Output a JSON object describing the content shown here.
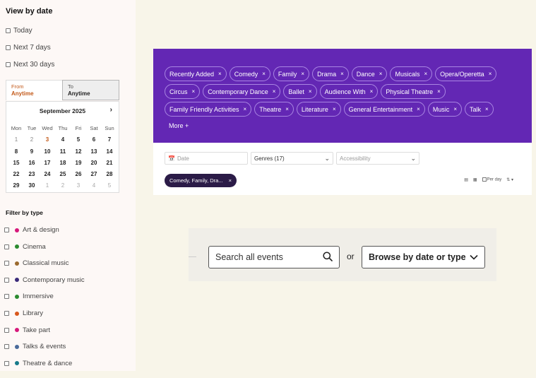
{
  "sidebar": {
    "view_by_date_title": "View by date",
    "date_options": [
      {
        "label": "Today"
      },
      {
        "label": "Next 7 days"
      },
      {
        "label": "Next 30 days"
      }
    ],
    "range": {
      "from_label": "From",
      "from_value": "Anytime",
      "to_label": "To",
      "to_value": "Anytime"
    },
    "calendar": {
      "month": "September 2025",
      "next_icon": "chevron-right-icon",
      "weekdays": [
        "Mon",
        "Tue",
        "Wed",
        "Thu",
        "Fri",
        "Sat",
        "Sun"
      ],
      "days": [
        {
          "d": "1",
          "s": "past"
        },
        {
          "d": "2",
          "s": "past"
        },
        {
          "d": "3",
          "s": "today"
        },
        {
          "d": "4",
          "s": "fut"
        },
        {
          "d": "5",
          "s": "fut"
        },
        {
          "d": "6",
          "s": "fut"
        },
        {
          "d": "7",
          "s": "fut"
        },
        {
          "d": "8",
          "s": "fut"
        },
        {
          "d": "9",
          "s": "fut"
        },
        {
          "d": "10",
          "s": "fut"
        },
        {
          "d": "11",
          "s": "fut"
        },
        {
          "d": "12",
          "s": "fut"
        },
        {
          "d": "13",
          "s": "fut"
        },
        {
          "d": "14",
          "s": "fut"
        },
        {
          "d": "15",
          "s": "fut"
        },
        {
          "d": "16",
          "s": "fut"
        },
        {
          "d": "17",
          "s": "fut"
        },
        {
          "d": "18",
          "s": "fut"
        },
        {
          "d": "19",
          "s": "fut"
        },
        {
          "d": "20",
          "s": "fut"
        },
        {
          "d": "21",
          "s": "fut"
        },
        {
          "d": "22",
          "s": "fut"
        },
        {
          "d": "23",
          "s": "fut"
        },
        {
          "d": "24",
          "s": "fut"
        },
        {
          "d": "25",
          "s": "fut"
        },
        {
          "d": "26",
          "s": "fut"
        },
        {
          "d": "27",
          "s": "fut"
        },
        {
          "d": "28",
          "s": "fut"
        },
        {
          "d": "29",
          "s": "fut"
        },
        {
          "d": "30",
          "s": "fut"
        },
        {
          "d": "1",
          "s": "next"
        },
        {
          "d": "2",
          "s": "next"
        },
        {
          "d": "3",
          "s": "next"
        },
        {
          "d": "4",
          "s": "next"
        },
        {
          "d": "5",
          "s": "next"
        }
      ]
    },
    "filter_by_type_title": "Filter by type",
    "types": [
      {
        "label": "Art & design",
        "color": "#d6177a"
      },
      {
        "label": "Cinema",
        "color": "#2a8a2f"
      },
      {
        "label": "Classical music",
        "color": "#9b6a2f"
      },
      {
        "label": "Contemporary music",
        "color": "#3a2a7a"
      },
      {
        "label": "Immersive",
        "color": "#2a8a2f"
      },
      {
        "label": "Library",
        "color": "#d8571c"
      },
      {
        "label": "Take part",
        "color": "#d6177a"
      },
      {
        "label": "Talks & events",
        "color": "#4a6a9a"
      },
      {
        "label": "Theatre & dance",
        "color": "#177a8a"
      }
    ]
  },
  "filter_panel": {
    "accent_color": "#6327b4",
    "genre_tags": [
      "Recently Added",
      "Comedy",
      "Family",
      "Drama",
      "Dance",
      "Musicals",
      "Opera/Operetta",
      "Circus",
      "Contemporary Dance",
      "Ballet",
      "Audience With",
      "Physical Theatre",
      "Family Friendly Activities",
      "Theatre",
      "Literature",
      "General Entertainment",
      "Music",
      "Talk"
    ],
    "remove_glyph": "×",
    "more_label": "More +",
    "date_placeholder": "Date",
    "genres_select": "Genres (17)",
    "accessibility_select": "Accessibility",
    "active_chip": "Comedy, Family, Dra...",
    "per_day_label": "Per day"
  },
  "search_strip": {
    "search_placeholder": "Search all events",
    "or_label": "or",
    "browse_label": "Browse by date or type"
  }
}
